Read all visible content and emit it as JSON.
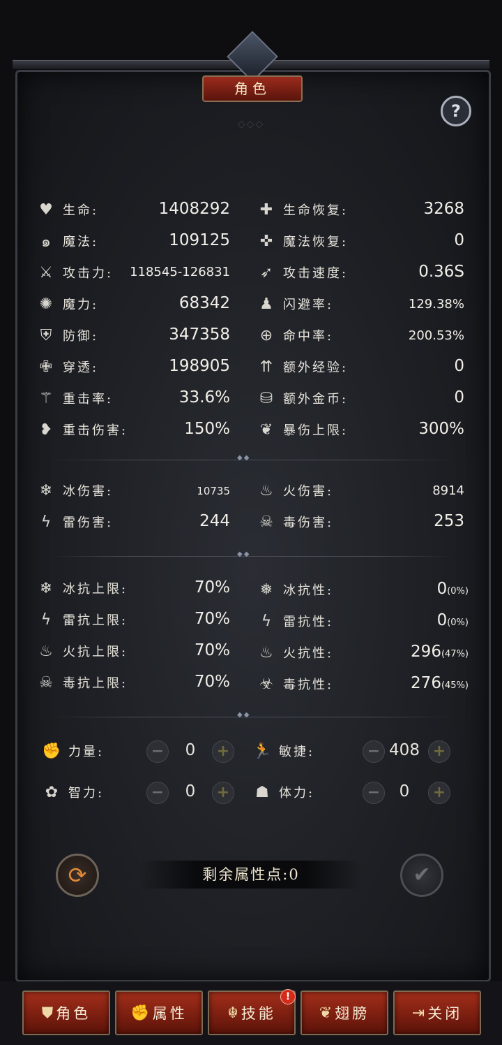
{
  "header": {
    "title": "角色",
    "help_label": "?"
  },
  "main_stats": [
    {
      "icon": "heart-icon",
      "label": "生命:",
      "value": "1408292"
    },
    {
      "icon": "mana-icon",
      "label": "魔法:",
      "value": "109125"
    },
    {
      "icon": "sword-icon",
      "label": "攻击力:",
      "value": "118545-126831"
    },
    {
      "icon": "magic-power-icon",
      "label": "魔力:",
      "value": "68342"
    },
    {
      "icon": "shield-icon",
      "label": "防御:",
      "value": "347358"
    },
    {
      "icon": "penetration-icon",
      "label": "穿透:",
      "value": "198905"
    },
    {
      "icon": "critical-rate-icon",
      "label": "重击率:",
      "value": "33.6%"
    },
    {
      "icon": "critical-damage-icon",
      "label": "重击伤害:",
      "value": "150%"
    }
  ],
  "main_stats_right": [
    {
      "icon": "life-regen-icon",
      "label": "生命恢复:",
      "value": "3268"
    },
    {
      "icon": "mana-regen-icon",
      "label": "魔法恢复:",
      "value": "0"
    },
    {
      "icon": "attack-speed-icon",
      "label": "攻击速度:",
      "value": "0.36S"
    },
    {
      "icon": "dodge-icon",
      "label": "闪避率:",
      "value": "129.38%"
    },
    {
      "icon": "target-icon",
      "label": "命中率:",
      "value": "200.53%"
    },
    {
      "icon": "extra-exp-icon",
      "label": "额外经验:",
      "value": "0"
    },
    {
      "icon": "coins-icon",
      "label": "额外金币:",
      "value": "0"
    },
    {
      "icon": "crit-cap-icon",
      "label": "暴伤上限:",
      "value": "300%"
    }
  ],
  "element_damage": [
    {
      "icon": "snowflake-icon",
      "label": "冰伤害:",
      "value": "10735"
    },
    {
      "icon": "fire-icon",
      "label": "火伤害:",
      "value": "8914"
    },
    {
      "icon": "lightning-icon",
      "label": "雷伤害:",
      "value": "244"
    },
    {
      "icon": "poison-icon",
      "label": "毒伤害:",
      "value": "253"
    }
  ],
  "resist_caps": [
    {
      "icon": "ice-resist-cap-icon",
      "label": "冰抗上限:",
      "value": "70%"
    },
    {
      "icon": "lightning-resist-cap-icon",
      "label": "雷抗上限:",
      "value": "70%"
    },
    {
      "icon": "fire-resist-cap-icon",
      "label": "火抗上限:",
      "value": "70%"
    },
    {
      "icon": "poison-resist-cap-icon",
      "label": "毒抗上限:",
      "value": "70%"
    }
  ],
  "resists": [
    {
      "icon": "ice-resist-icon",
      "label": "冰抗性:",
      "value": "0",
      "pct": "(0%)"
    },
    {
      "icon": "lightning-resist-icon",
      "label": "雷抗性:",
      "value": "0",
      "pct": "(0%)"
    },
    {
      "icon": "fire-resist-icon",
      "label": "火抗性:",
      "value": "296",
      "pct": "(47%)"
    },
    {
      "icon": "poison-resist-icon",
      "label": "毒抗性:",
      "value": "276",
      "pct": "(45%)"
    }
  ],
  "attributes": [
    {
      "icon": "strength-icon",
      "label": "力量:",
      "value": "0"
    },
    {
      "icon": "agility-icon",
      "label": "敏捷:",
      "value": "408"
    },
    {
      "icon": "intelligence-icon",
      "label": "智力:",
      "value": "0"
    },
    {
      "icon": "stamina-icon",
      "label": "体力:",
      "value": "0"
    }
  ],
  "controls": {
    "minus": "−",
    "plus": "+"
  },
  "remaining": "剩余属性点:0",
  "tabs": [
    {
      "icon": "armor-icon",
      "label": "角色"
    },
    {
      "icon": "fist-icon",
      "label": "属性"
    },
    {
      "icon": "skill-icon",
      "label": "技能"
    },
    {
      "icon": "wings-icon",
      "label": "翅膀"
    },
    {
      "icon": "exit-icon",
      "label": "关闭"
    }
  ],
  "notification_badge": "!"
}
